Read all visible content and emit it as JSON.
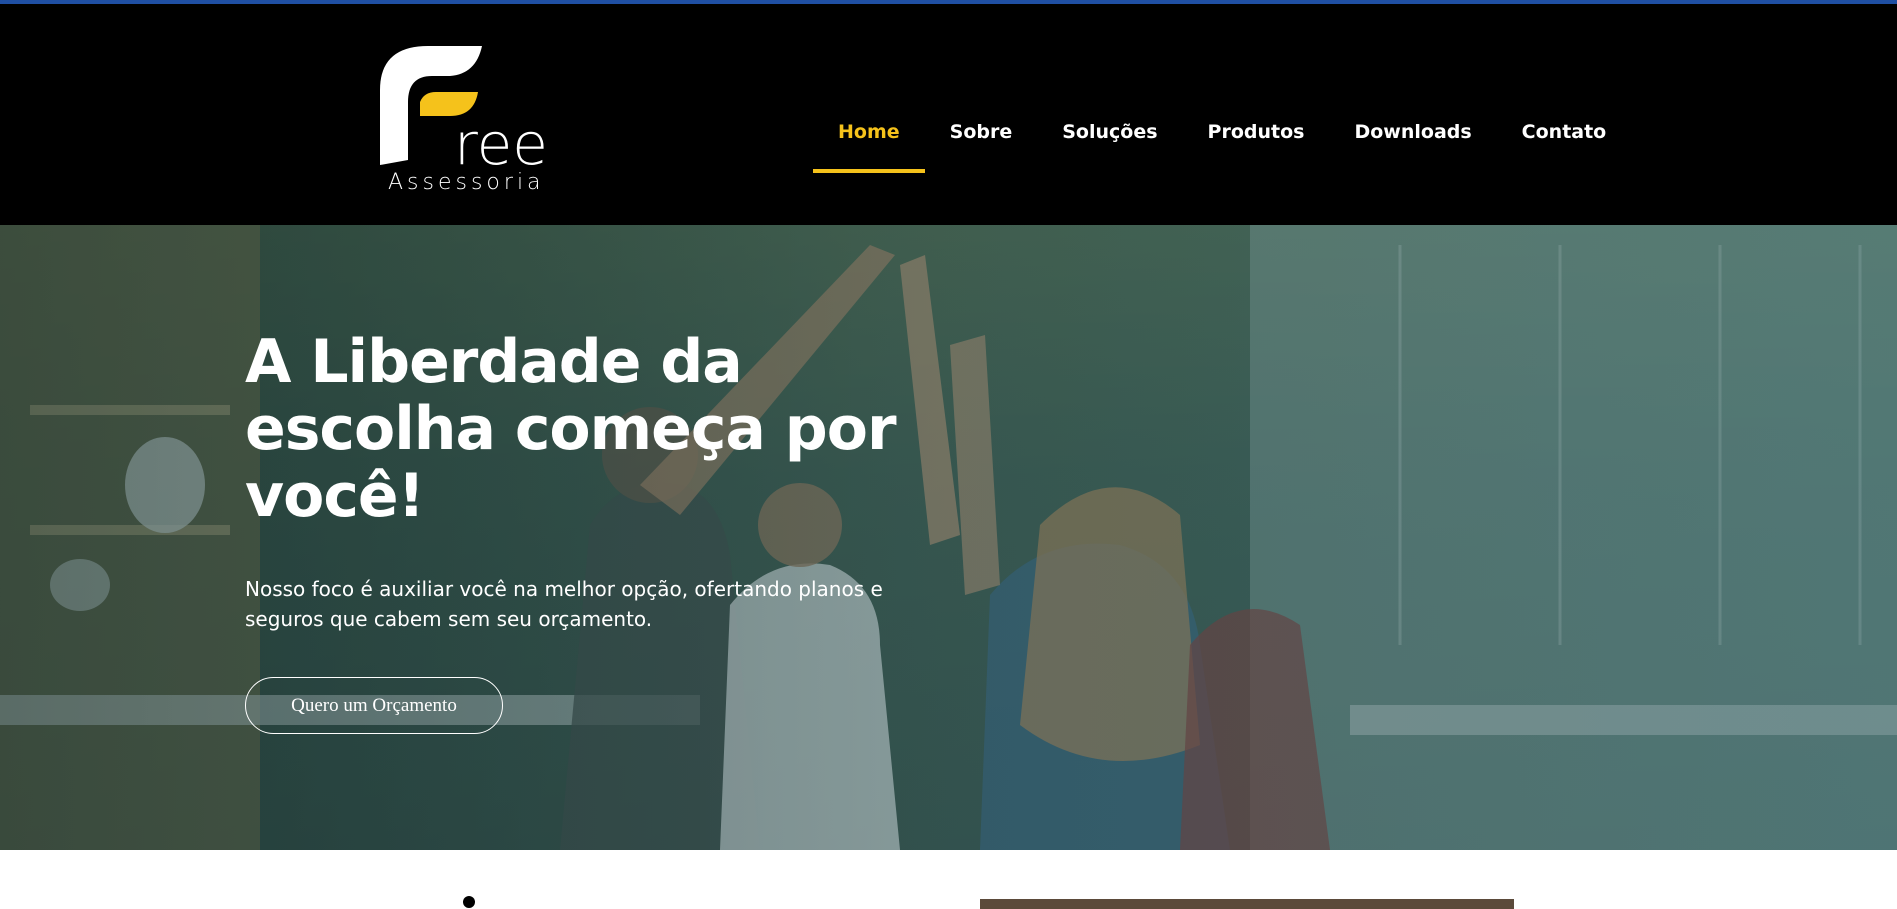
{
  "header": {
    "logo_letters": "ree",
    "logo_subtitle": "Assessoria",
    "nav": [
      {
        "label": "Home",
        "active": true
      },
      {
        "label": "Sobre",
        "active": false
      },
      {
        "label": "Soluções",
        "active": false
      },
      {
        "label": "Produtos",
        "active": false
      },
      {
        "label": "Downloads",
        "active": false
      },
      {
        "label": "Contato",
        "active": false
      }
    ]
  },
  "hero": {
    "title": "A Liberdade da escolha começa por você!",
    "text": "Nosso foco é auxiliar você na melhor opção, ofertando planos e seguros que cabem sem seu orçamento.",
    "button_label": "Quero um Orçamento"
  },
  "colors": {
    "accent": "#f5c21b",
    "header_bg": "#000000",
    "top_border": "#1f4fa3"
  }
}
